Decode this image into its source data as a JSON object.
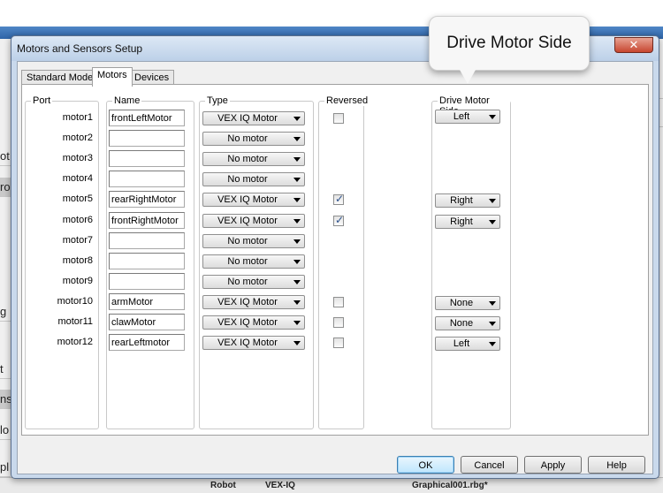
{
  "background": {
    "left_fragments": [
      "ot",
      "ro",
      "g",
      "t",
      "ns",
      "lo",
      "pl"
    ],
    "bottom_cells": [
      "Robot",
      "VEX-IQ",
      "Graphical001.rbg*"
    ]
  },
  "dialog": {
    "title": "Motors and Sensors Setup",
    "close_label": "✕",
    "tabs": [
      {
        "label": "Standard Models",
        "active": false
      },
      {
        "label": "Motors",
        "active": true
      },
      {
        "label": "Devices",
        "active": false
      }
    ],
    "columns": {
      "port": "Port",
      "name": "Name",
      "type": "Type",
      "reversed": "Reversed",
      "drive_side": "Drive Motor Side"
    },
    "motors": [
      {
        "port": "motor1",
        "name": "frontLeftMotor",
        "type": "VEX IQ Motor",
        "has_reversed": true,
        "reversed": false,
        "drive_side": "Left"
      },
      {
        "port": "motor2",
        "name": "",
        "type": "No motor",
        "has_reversed": false,
        "reversed": false,
        "drive_side": ""
      },
      {
        "port": "motor3",
        "name": "",
        "type": "No motor",
        "has_reversed": false,
        "reversed": false,
        "drive_side": ""
      },
      {
        "port": "motor4",
        "name": "",
        "type": "No motor",
        "has_reversed": false,
        "reversed": false,
        "drive_side": ""
      },
      {
        "port": "motor5",
        "name": "rearRightMotor",
        "type": "VEX IQ Motor",
        "has_reversed": true,
        "reversed": true,
        "drive_side": "Right"
      },
      {
        "port": "motor6",
        "name": "frontRightMotor",
        "type": "VEX IQ Motor",
        "has_reversed": true,
        "reversed": true,
        "drive_side": "Right"
      },
      {
        "port": "motor7",
        "name": "",
        "type": "No motor",
        "has_reversed": false,
        "reversed": false,
        "drive_side": ""
      },
      {
        "port": "motor8",
        "name": "",
        "type": "No motor",
        "has_reversed": false,
        "reversed": false,
        "drive_side": ""
      },
      {
        "port": "motor9",
        "name": "",
        "type": "No motor",
        "has_reversed": false,
        "reversed": false,
        "drive_side": ""
      },
      {
        "port": "motor10",
        "name": "armMotor",
        "type": "VEX IQ Motor",
        "has_reversed": true,
        "reversed": false,
        "drive_side": "None"
      },
      {
        "port": "motor11",
        "name": "clawMotor",
        "type": "VEX IQ Motor",
        "has_reversed": true,
        "reversed": false,
        "drive_side": "None"
      },
      {
        "port": "motor12",
        "name": "rearLeftmotor",
        "type": "VEX IQ Motor",
        "has_reversed": true,
        "reversed": false,
        "drive_side": "Left"
      }
    ],
    "buttons": {
      "ok": "OK",
      "cancel": "Cancel",
      "apply": "Apply",
      "help": "Help"
    }
  },
  "callout": {
    "text": "Drive Motor Side"
  },
  "icons": {
    "dropdown": "chevron-down-icon",
    "check": "checkmark-icon",
    "close": "close-icon"
  }
}
